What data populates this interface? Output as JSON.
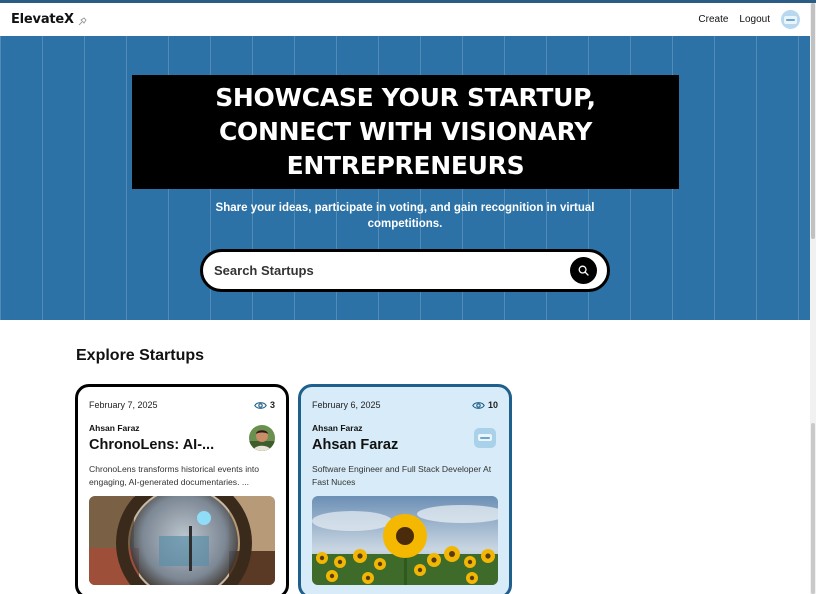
{
  "nav": {
    "logo": "ElevateX",
    "links": [
      {
        "label": "Create"
      },
      {
        "label": "Logout"
      }
    ]
  },
  "hero": {
    "title_lines": [
      "SHOWCASE YOUR STARTUP,",
      "CONNECT WITH VISIONARY",
      "ENTREPRENEURS"
    ],
    "subtitle": "Share your ideas, participate in voting, and gain recognition in virtual competitions.",
    "search_placeholder": "Search Startups"
  },
  "explore": {
    "title": "Explore Startups",
    "cards": [
      {
        "date": "February 7, 2025",
        "views": "3",
        "author": "Ahsan Faraz",
        "title": "ChronoLens: AI-...",
        "description": "ChronoLens transforms historical events into engaging, AI-generated documentaries. ...",
        "image": "room-through-lens-photo"
      },
      {
        "date": "February 6, 2025",
        "views": "10",
        "author": "Ahsan Faraz",
        "title": "Ahsan Faraz",
        "description": "Software Engineer and Full Stack Developer At Fast Nuces",
        "image": "sunflower-field-photo"
      }
    ]
  },
  "colors": {
    "hero_bg": "#2c72a6",
    "card_active_bg": "#d7ecf8",
    "card_active_border": "#1e5f8c"
  }
}
